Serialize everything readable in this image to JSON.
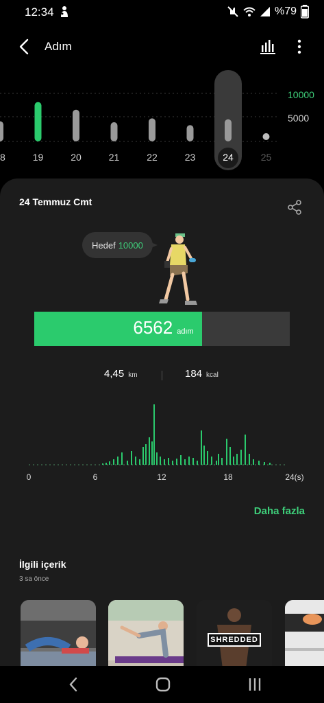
{
  "status_bar": {
    "time": "12:34",
    "battery": "%79",
    "icons": [
      "mute-icon",
      "wifi-icon",
      "signal-icon"
    ]
  },
  "header": {
    "title": "Adım"
  },
  "week": {
    "days": [
      "18",
      "19",
      "20",
      "21",
      "22",
      "23",
      "24",
      "25"
    ],
    "steps_fraction_of_10000": [
      0.42,
      0.82,
      0.66,
      0.4,
      0.48,
      0.34,
      0.46,
      0.0
    ],
    "selected_day": "24",
    "goal_line_label": "10000",
    "half_line_label": "5000",
    "goal_day": "19"
  },
  "card": {
    "date": "24 Temmuz Cmt",
    "goal_prefix": "Hedef",
    "goal_value": "10000",
    "steps": "6562",
    "steps_unit": "adım",
    "steps_progress": 0.656,
    "distance": "4,45",
    "distance_unit": "km",
    "calories": "184",
    "calories_unit": "kcal",
    "hourly_ticks": [
      "0",
      "6",
      "12",
      "18",
      "24(s)"
    ],
    "more_link": "Daha fazla"
  },
  "related": {
    "title": "İlgili içerik",
    "time": "3 sa önce",
    "badge_text": "SHREDDED"
  },
  "colors": {
    "accent": "#2bcb6d",
    "accent_text": "#3ecf7a",
    "card_bg": "#1c1c1c",
    "bar_gray": "#9a9a9a"
  }
}
